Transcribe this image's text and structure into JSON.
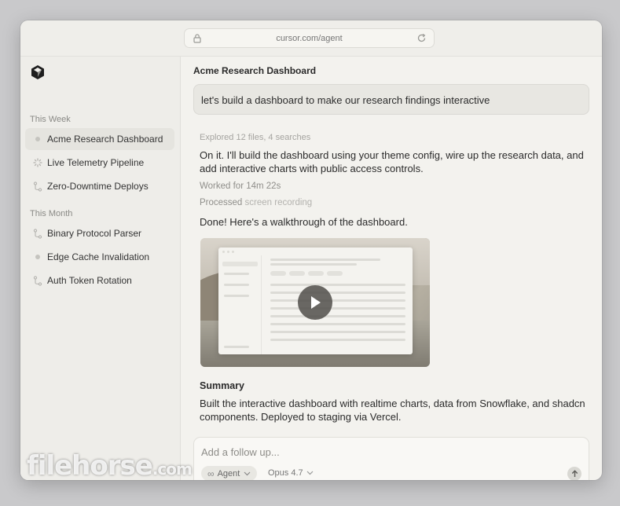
{
  "browser": {
    "url": "cursor.com/agent"
  },
  "sidebar": {
    "sections": [
      {
        "title": "This Week"
      },
      {
        "title": "This Month"
      }
    ],
    "items": [
      {
        "label": "Acme Research Dashboard",
        "icon": "dot-icon",
        "active": true
      },
      {
        "label": "Live Telemetry Pipeline",
        "icon": "spinner-icon"
      },
      {
        "label": "Zero-Downtime Deploys",
        "icon": "branch-icon"
      },
      {
        "label": "Binary Protocol Parser",
        "icon": "branch-icon"
      },
      {
        "label": "Edge Cache Invalidation",
        "icon": "dot-icon"
      },
      {
        "label": "Auth Token Rotation",
        "icon": "branch-icon"
      }
    ]
  },
  "thread": {
    "title": "Acme Research Dashboard",
    "user_message": "let's build a dashboard to make our research findings interactive",
    "explored": "Explored 12 files, 4 searches",
    "reply": "On it. I'll build the dashboard using your theme config, wire up the research data, and add interactive charts with public access controls.",
    "worked_for": "Worked for 14m 22s",
    "processed_label": "Processed",
    "processed_value": "screen recording",
    "done_text": "Done! Here's a walkthrough of the dashboard.",
    "summary_title": "Summary",
    "summary_text": "Built the interactive dashboard with realtime charts, data from Snowflake, and shadcn components. Deployed to staging via Vercel."
  },
  "composer": {
    "placeholder": "Add a follow up...",
    "mode": "Agent",
    "model": "Opus 4.7"
  },
  "watermark": {
    "text": "filehorse",
    "suffix": ".com"
  }
}
